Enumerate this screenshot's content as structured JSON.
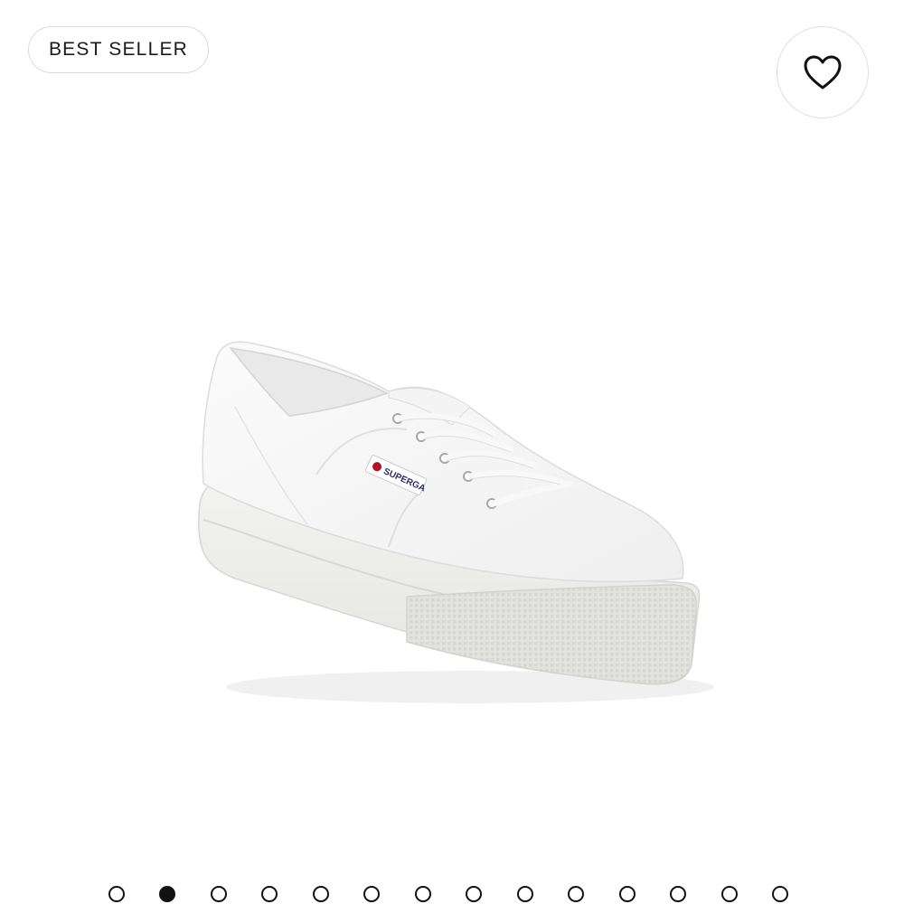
{
  "badge": {
    "label": "BEST SELLER"
  },
  "product": {
    "brand_label": "SUPERGA",
    "colors": {
      "canvas": "#f6f6f6",
      "sole": "#ededeb",
      "tag_red": "#b3122a"
    }
  },
  "wishlist": {
    "icon": "heart-outline-icon"
  },
  "carousel": {
    "total": 14,
    "active_index": 1
  },
  "colors": {
    "accent": "#111111",
    "border": "#dcdcdc",
    "background": "#ffffff"
  }
}
